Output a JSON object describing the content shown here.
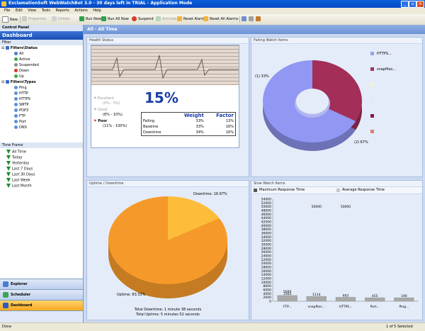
{
  "window": {
    "title": "ExclamationSoft WebWatchBot 3.0 - 30 days left in TRIAL - Application Mode"
  },
  "menu": [
    "File",
    "Edit",
    "View",
    "Tools",
    "Reports",
    "Actions",
    "Help"
  ],
  "toolbar": {
    "new": "New",
    "properties": "Properties",
    "delete": "Delete",
    "run_now": "Run Now",
    "run_all_now": "Run All Now",
    "suspend": "Suspend",
    "activate": "Activate",
    "reset_alarm": "Reset Alarm",
    "reset_all_alarms": "Reset All Alarms"
  },
  "sidebar": {
    "control_panel": "Control Panel",
    "title": "Dashboard",
    "filter_label": "Filter",
    "status_group": "Filters\\Status",
    "status_items": [
      "All",
      "Active",
      "Suspended",
      "Down",
      "Up"
    ],
    "types_group": "Filters\\Types",
    "type_items": [
      "Ping",
      "HTTP",
      "HTTPS",
      "SMTP",
      "POP3",
      "FTP",
      "Port",
      "DNS"
    ],
    "timeframe_label": "Time Frame",
    "time_items": [
      "All Time",
      "Today",
      "Yesterday",
      "Last 7 Days",
      "Last 30 Days",
      "Last Week",
      "Last Month"
    ],
    "nav": [
      "Explorer",
      "Scheduler",
      "Dashboard"
    ]
  },
  "main": {
    "header": "All - All Time"
  },
  "health": {
    "title": "Health Status",
    "percent": "15%",
    "excellent": "Excellent",
    "excellent_range": "(0% - 5%)",
    "good": "Good",
    "good_range": "(6% - 10%)",
    "poor": "Poor",
    "poor_range": "(11% - 100%)",
    "col_weight": "Weight",
    "col_factor": "Factor",
    "rows": [
      {
        "name": "Failing",
        "weight": "33%",
        "factor": "13%"
      },
      {
        "name": "Baseline",
        "weight": "33%",
        "factor": "16%"
      },
      {
        "name": "Downtime",
        "weight": "34%",
        "factor": "16%"
      }
    ]
  },
  "failing": {
    "title": "Failing Watch Items",
    "label_a": "(1) 33%",
    "label_b": "(2) 67%",
    "legend": [
      {
        "name": "HTTPS...",
        "color": "#9aa0f2"
      },
      {
        "name": "snapfiles...",
        "color": "#a8315c"
      },
      {
        "name": "",
        "color": "#f6f3c4"
      },
      {
        "name": "",
        "color": "#d9eef6"
      },
      {
        "name": "",
        "color": "#8a1448"
      },
      {
        "name": "",
        "color": "#e0816a"
      }
    ],
    "slices": [
      {
        "fraction": 0.33,
        "color": "#a32e58"
      },
      {
        "fraction": 0.67,
        "color": "#9197f2"
      }
    ]
  },
  "uptime": {
    "title": "Uptime / Downtime",
    "downtime_label": "Downtime: 16.67%",
    "uptime_label": "Uptime: 83.33%",
    "total_downtime": "Total Downtime: 1 minute 38 seconds",
    "total_uptime": "Total Uptime: 5 minutes 52 seconds",
    "slices": [
      {
        "fraction": 0.1667,
        "color": "#fdbd3a"
      },
      {
        "fraction": 0.8333,
        "color": "#f59a2a"
      }
    ]
  },
  "slow": {
    "title": "Slow Watch Items",
    "legend_max": "Maximum Response Time",
    "legend_avg": "Average Response Time"
  },
  "chart_data": {
    "type": "bar",
    "categories": [
      "FTP...",
      "snapfiles...",
      "HTTPS...",
      "Port...",
      "Ping..."
    ],
    "series": [
      {
        "name": "Maximum Response Time",
        "values": [
          1563,
          1114,
          603,
          10,
          190
        ]
      },
      {
        "name": "Average Response Time",
        "values": [
          5000,
          50000,
          50000,
          0,
          0
        ]
      }
    ],
    "bar_labels": [
      "1563",
      "1114",
      "603",
      "455",
      "190"
    ],
    "top_labels": [
      "5000",
      "50000",
      "50000",
      "",
      ""
    ],
    "yticks": [
      0,
      2000,
      4000,
      6000,
      8000,
      10000,
      12000,
      14000,
      16000,
      18000,
      20000,
      22000,
      24000,
      26000,
      28000,
      30000,
      32000,
      34000,
      36000,
      38000,
      40000,
      42000,
      44000,
      46000,
      48000,
      50000,
      52000,
      54000
    ],
    "ylim": [
      0,
      54000
    ]
  },
  "status": {
    "left": "Done",
    "right": "1 of 5 Selected"
  }
}
